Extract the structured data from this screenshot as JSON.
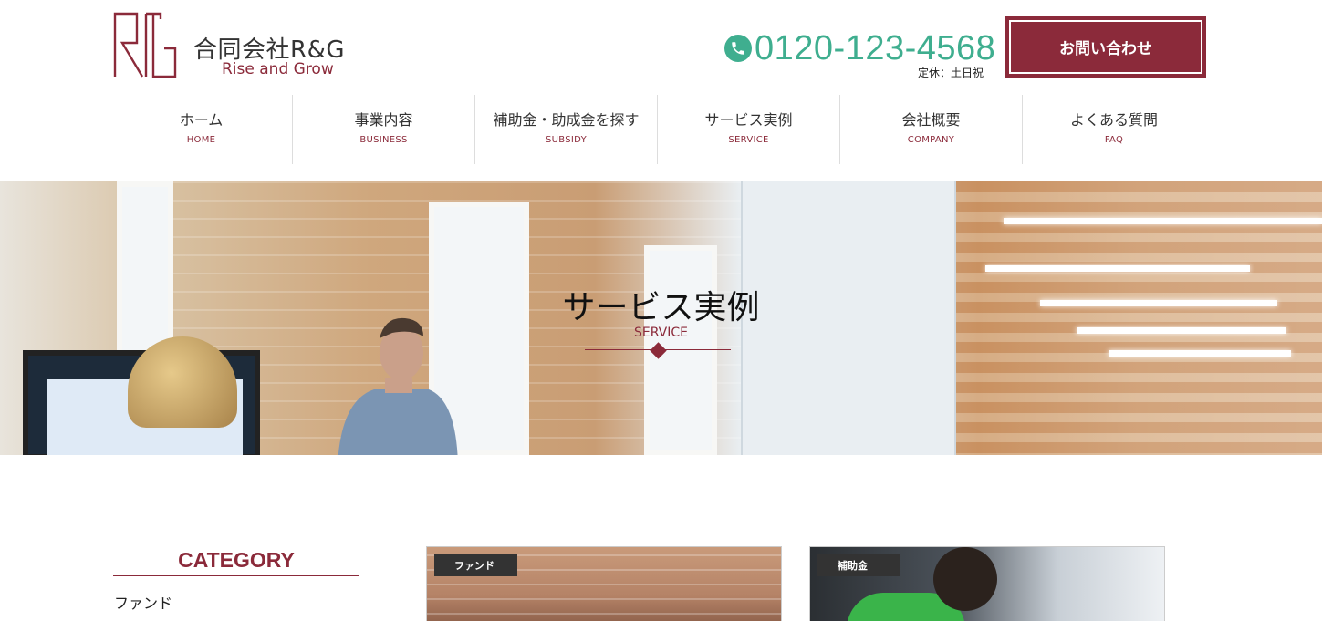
{
  "header": {
    "company_name": "合同会社R&G",
    "tagline": "Rise and Grow",
    "phone": "0120-123-4568",
    "holiday": "定休：土日祝",
    "contact_label": "お問い合わせ"
  },
  "nav": {
    "items": [
      {
        "jp": "ホーム",
        "en": "HOME"
      },
      {
        "jp": "事業内容",
        "en": "BUSINESS"
      },
      {
        "jp": "補助金・助成金を探す",
        "en": "SUBSIDY"
      },
      {
        "jp": "サービス実例",
        "en": "SERVICE"
      },
      {
        "jp": "会社概要",
        "en": "COMPANY"
      },
      {
        "jp": "よくある質問",
        "en": "FAQ"
      }
    ]
  },
  "hero": {
    "title": "サービス実例",
    "subtitle": "SERVICE"
  },
  "sidebar": {
    "title": "CATEGORY",
    "items": [
      "ファンド"
    ]
  },
  "cards": [
    {
      "tag": "ファンド"
    },
    {
      "tag": "補助金"
    }
  ],
  "colors": {
    "brand": "#8b2a3a",
    "phone": "#3fae8f"
  }
}
